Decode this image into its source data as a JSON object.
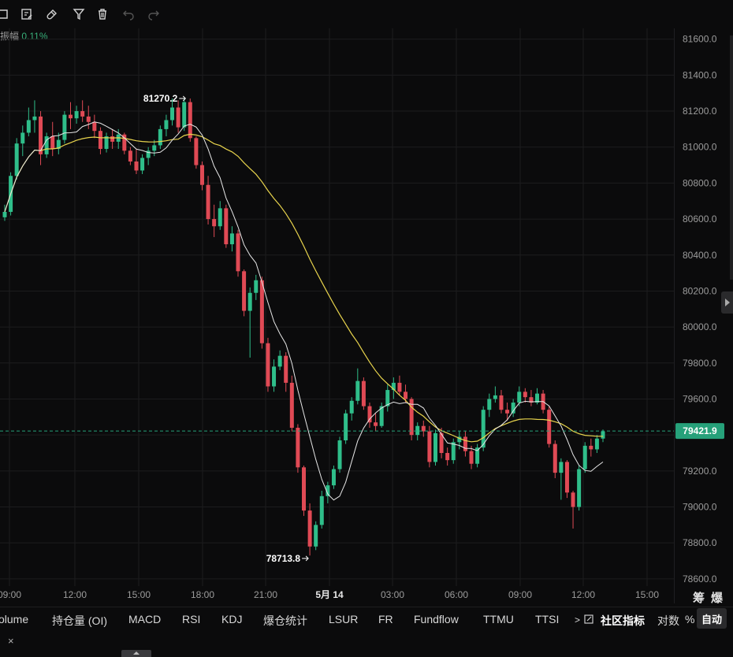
{
  "toolbar": {
    "icons": [
      "frame-icon",
      "edit-note-icon",
      "magnet-icon",
      "filter-icon",
      "trash-icon",
      "undo-icon",
      "redo-icon"
    ]
  },
  "amplitude": {
    "label": "振幅",
    "value": "0.11%"
  },
  "colors": {
    "up": "#2fbe8a",
    "down": "#e04a55",
    "ma_fast": "#e6e6e6",
    "ma_slow": "#e8d44d",
    "grid": "#1c1c1e",
    "price_tag": "#26a17a"
  },
  "chart_data": {
    "type": "candlestick",
    "y_ticks": [
      "81600.0",
      "81400.0",
      "81200.0",
      "81000.0",
      "80800.0",
      "80600.0",
      "80400.0",
      "80200.0",
      "80000.0",
      "79800.0",
      "79600.0",
      "79400.0",
      "79200.0",
      "79000.0",
      "78800.0",
      "78600.0"
    ],
    "ylim": [
      78560,
      81660
    ],
    "x_ticks": [
      "09:00",
      "12:00",
      "15:00",
      "18:00",
      "21:00",
      "5月 14",
      "03:00",
      "06:00",
      "09:00",
      "12:00",
      "15:00"
    ],
    "last_price": "79421.9",
    "high_label": "81270.2",
    "low_label": "78713.8",
    "candles": [
      [
        80610,
        80680,
        80590,
        80640
      ],
      [
        80640,
        80860,
        80620,
        80840
      ],
      [
        80840,
        81050,
        80820,
        81020
      ],
      [
        81020,
        81120,
        80950,
        81080
      ],
      [
        81080,
        81220,
        81060,
        81150
      ],
      [
        81150,
        81260,
        81080,
        81170
      ],
      [
        81170,
        81200,
        80900,
        80960
      ],
      [
        80960,
        81080,
        80940,
        81060
      ],
      [
        81060,
        81140,
        80950,
        80990
      ],
      [
        80990,
        81080,
        80960,
        81040
      ],
      [
        81040,
        81200,
        81020,
        81180
      ],
      [
        81180,
        81250,
        81100,
        81160
      ],
      [
        81160,
        81230,
        81130,
        81200
      ],
      [
        81200,
        81260,
        81140,
        81170
      ],
      [
        81170,
        81230,
        81100,
        81140
      ],
      [
        81140,
        81180,
        81050,
        81090
      ],
      [
        81090,
        81110,
        80960,
        80990
      ],
      [
        80990,
        81080,
        80970,
        81060
      ],
      [
        81060,
        81100,
        80990,
        81030
      ],
      [
        81030,
        81100,
        80990,
        81070
      ],
      [
        81070,
        81080,
        80960,
        80980
      ],
      [
        80980,
        81000,
        80900,
        80920
      ],
      [
        80920,
        80990,
        80850,
        80870
      ],
      [
        80870,
        80960,
        80850,
        80940
      ],
      [
        80940,
        81000,
        80900,
        80980
      ],
      [
        80980,
        81040,
        80950,
        81010
      ],
      [
        81010,
        81120,
        80990,
        81100
      ],
      [
        81100,
        81180,
        81060,
        81150
      ],
      [
        81150,
        81270,
        81120,
        81220
      ],
      [
        81220,
        81260,
        81080,
        81110
      ],
      [
        81110,
        81270,
        81090,
        81250
      ],
      [
        81250,
        81270,
        81030,
        81050
      ],
      [
        81050,
        81060,
        80880,
        80900
      ],
      [
        80900,
        80920,
        80760,
        80790
      ],
      [
        80790,
        80840,
        80570,
        80600
      ],
      [
        80600,
        80680,
        80500,
        80560
      ],
      [
        80560,
        80700,
        80540,
        80660
      ],
      [
        80660,
        80680,
        80440,
        80460
      ],
      [
        80460,
        80560,
        80420,
        80520
      ],
      [
        80520,
        80540,
        80280,
        80310
      ],
      [
        80310,
        80320,
        80060,
        80090
      ],
      [
        80090,
        80220,
        79830,
        80190
      ],
      [
        80190,
        80290,
        80150,
        80260
      ],
      [
        80260,
        80280,
        79880,
        79910
      ],
      [
        79910,
        79940,
        79640,
        79670
      ],
      [
        79670,
        79820,
        79640,
        79780
      ],
      [
        79780,
        79870,
        79760,
        79840
      ],
      [
        79840,
        79860,
        79640,
        79690
      ],
      [
        79690,
        79730,
        79420,
        79440
      ],
      [
        79440,
        79460,
        79190,
        79220
      ],
      [
        79220,
        79230,
        78950,
        78980
      ],
      [
        78980,
        79020,
        78730,
        78780
      ],
      [
        78780,
        78920,
        78760,
        78900
      ],
      [
        78900,
        79090,
        78880,
        79060
      ],
      [
        79060,
        79140,
        79020,
        79120
      ],
      [
        79120,
        79230,
        79100,
        79210
      ],
      [
        79210,
        79390,
        79190,
        79370
      ],
      [
        79370,
        79540,
        79350,
        79520
      ],
      [
        79520,
        79610,
        79480,
        79590
      ],
      [
        79590,
        79770,
        79570,
        79700
      ],
      [
        79700,
        79720,
        79540,
        79560
      ],
      [
        79560,
        79580,
        79440,
        79470
      ],
      [
        79470,
        79520,
        79420,
        79450
      ],
      [
        79450,
        79580,
        79440,
        79560
      ],
      [
        79560,
        79680,
        79530,
        79650
      ],
      [
        79650,
        79720,
        79600,
        79690
      ],
      [
        79690,
        79730,
        79620,
        79640
      ],
      [
        79640,
        79680,
        79580,
        79600
      ],
      [
        79600,
        79610,
        79370,
        79400
      ],
      [
        79400,
        79470,
        79370,
        79450
      ],
      [
        79450,
        79480,
        79390,
        79420
      ],
      [
        79420,
        79450,
        79220,
        79250
      ],
      [
        79250,
        79430,
        79230,
        79410
      ],
      [
        79410,
        79440,
        79270,
        79300
      ],
      [
        79300,
        79330,
        79230,
        79260
      ],
      [
        79260,
        79380,
        79240,
        79360
      ],
      [
        79360,
        79420,
        79320,
        79390
      ],
      [
        79390,
        79420,
        79280,
        79310
      ],
      [
        79310,
        79340,
        79210,
        79240
      ],
      [
        79240,
        79350,
        79220,
        79330
      ],
      [
        79330,
        79560,
        79310,
        79540
      ],
      [
        79540,
        79630,
        79500,
        79600
      ],
      [
        79600,
        79670,
        79580,
        79620
      ],
      [
        79620,
        79650,
        79520,
        79540
      ],
      [
        79540,
        79580,
        79480,
        79520
      ],
      [
        79520,
        79600,
        79500,
        79580
      ],
      [
        79580,
        79670,
        79560,
        79640
      ],
      [
        79640,
        79660,
        79580,
        79610
      ],
      [
        79610,
        79650,
        79560,
        79580
      ],
      [
        79580,
        79660,
        79570,
        79630
      ],
      [
        79630,
        79650,
        79520,
        79540
      ],
      [
        79540,
        79560,
        79330,
        79350
      ],
      [
        79350,
        79370,
        79160,
        79190
      ],
      [
        79190,
        79270,
        79040,
        79250
      ],
      [
        79250,
        79260,
        79050,
        79080
      ],
      [
        79080,
        79090,
        78880,
        79000
      ],
      [
        79000,
        79230,
        78980,
        79210
      ],
      [
        79210,
        79360,
        79190,
        79340
      ],
      [
        79340,
        79380,
        79280,
        79320
      ],
      [
        79320,
        79400,
        79300,
        79380
      ],
      [
        79380,
        79430,
        79360,
        79420
      ]
    ]
  },
  "indicators": [
    "olume",
    "持仓量 (OI)",
    "MACD",
    "RSI",
    "KDJ",
    "爆仓统计",
    "LSUR",
    "FR",
    "Fundflow",
    "TTMU",
    "TTSI"
  ],
  "community": "社区指标",
  "log_label": "对数",
  "pct_label": "%",
  "auto_label": "自动",
  "corner_labels": [
    "筹",
    "爆"
  ],
  "close_label": "×",
  "more_label": ">"
}
